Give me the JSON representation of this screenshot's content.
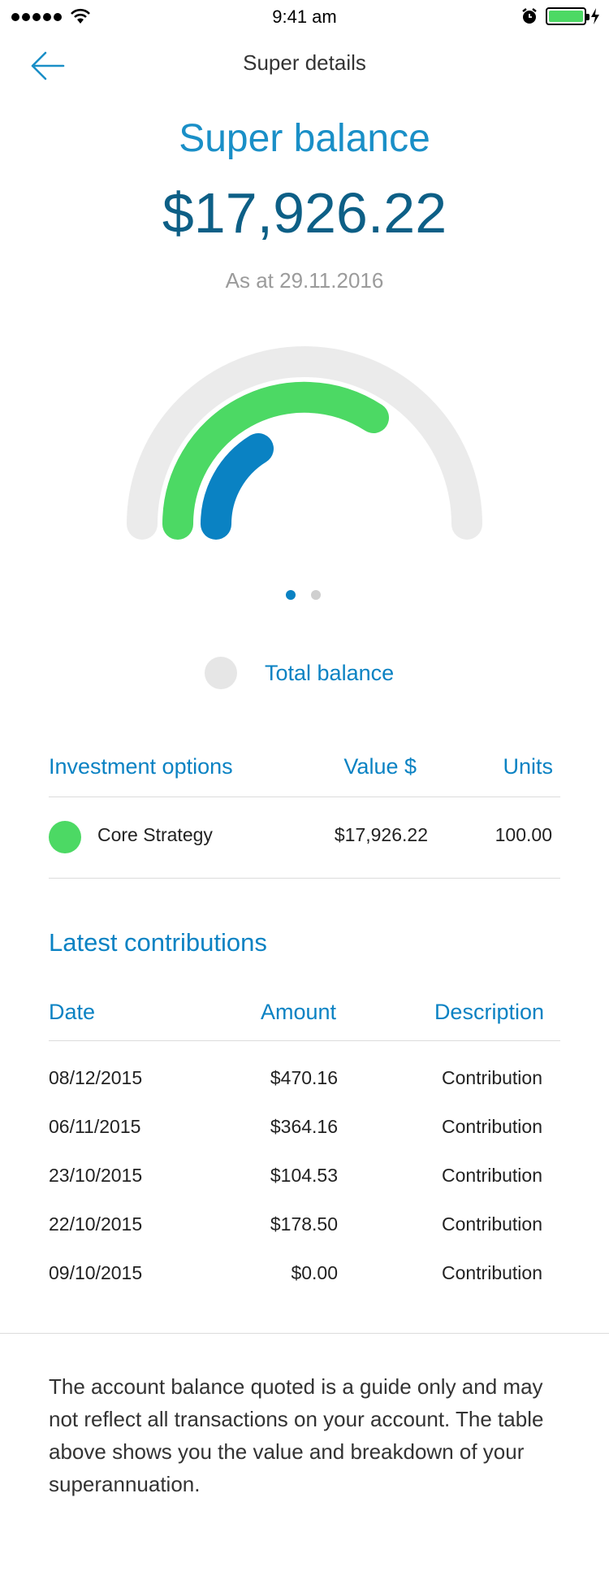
{
  "status_bar": {
    "time": "9:41 am"
  },
  "nav": {
    "title": "Super details"
  },
  "summary": {
    "heading": "Super balance",
    "amount": "$17,926.22",
    "as_at": "As at 29.11.2016"
  },
  "chart": {
    "track_color": "#ebebeb",
    "series_colors": [
      "#4cd964",
      "#0a82c3"
    ]
  },
  "pager": {
    "pages": 2,
    "active": 1
  },
  "legend": {
    "label": "Total balance"
  },
  "investments": {
    "headers": [
      "Investment options",
      "Value $",
      "Units"
    ],
    "rows": [
      {
        "name": "Core Strategy",
        "value": "$17,926.22",
        "units": "100.00",
        "color": "#4cd964"
      }
    ]
  },
  "contributions": {
    "title": "Latest contributions",
    "headers": [
      "Date",
      "Amount",
      "Description"
    ],
    "rows": [
      [
        "08/12/2015",
        "$470.16",
        "Contribution"
      ],
      [
        "06/11/2015",
        "$364.16",
        "Contribution"
      ],
      [
        "23/10/2015",
        "$104.53",
        "Contribution"
      ],
      [
        "22/10/2015",
        "$178.50",
        "Contribution"
      ],
      [
        "09/10/2015",
        "$0.00",
        "Contribution"
      ]
    ]
  },
  "disclaimer": "The account balance quoted is a guide only and may not reflect all transactions on your account. The table above shows you the value and breakdown of your superannuation."
}
